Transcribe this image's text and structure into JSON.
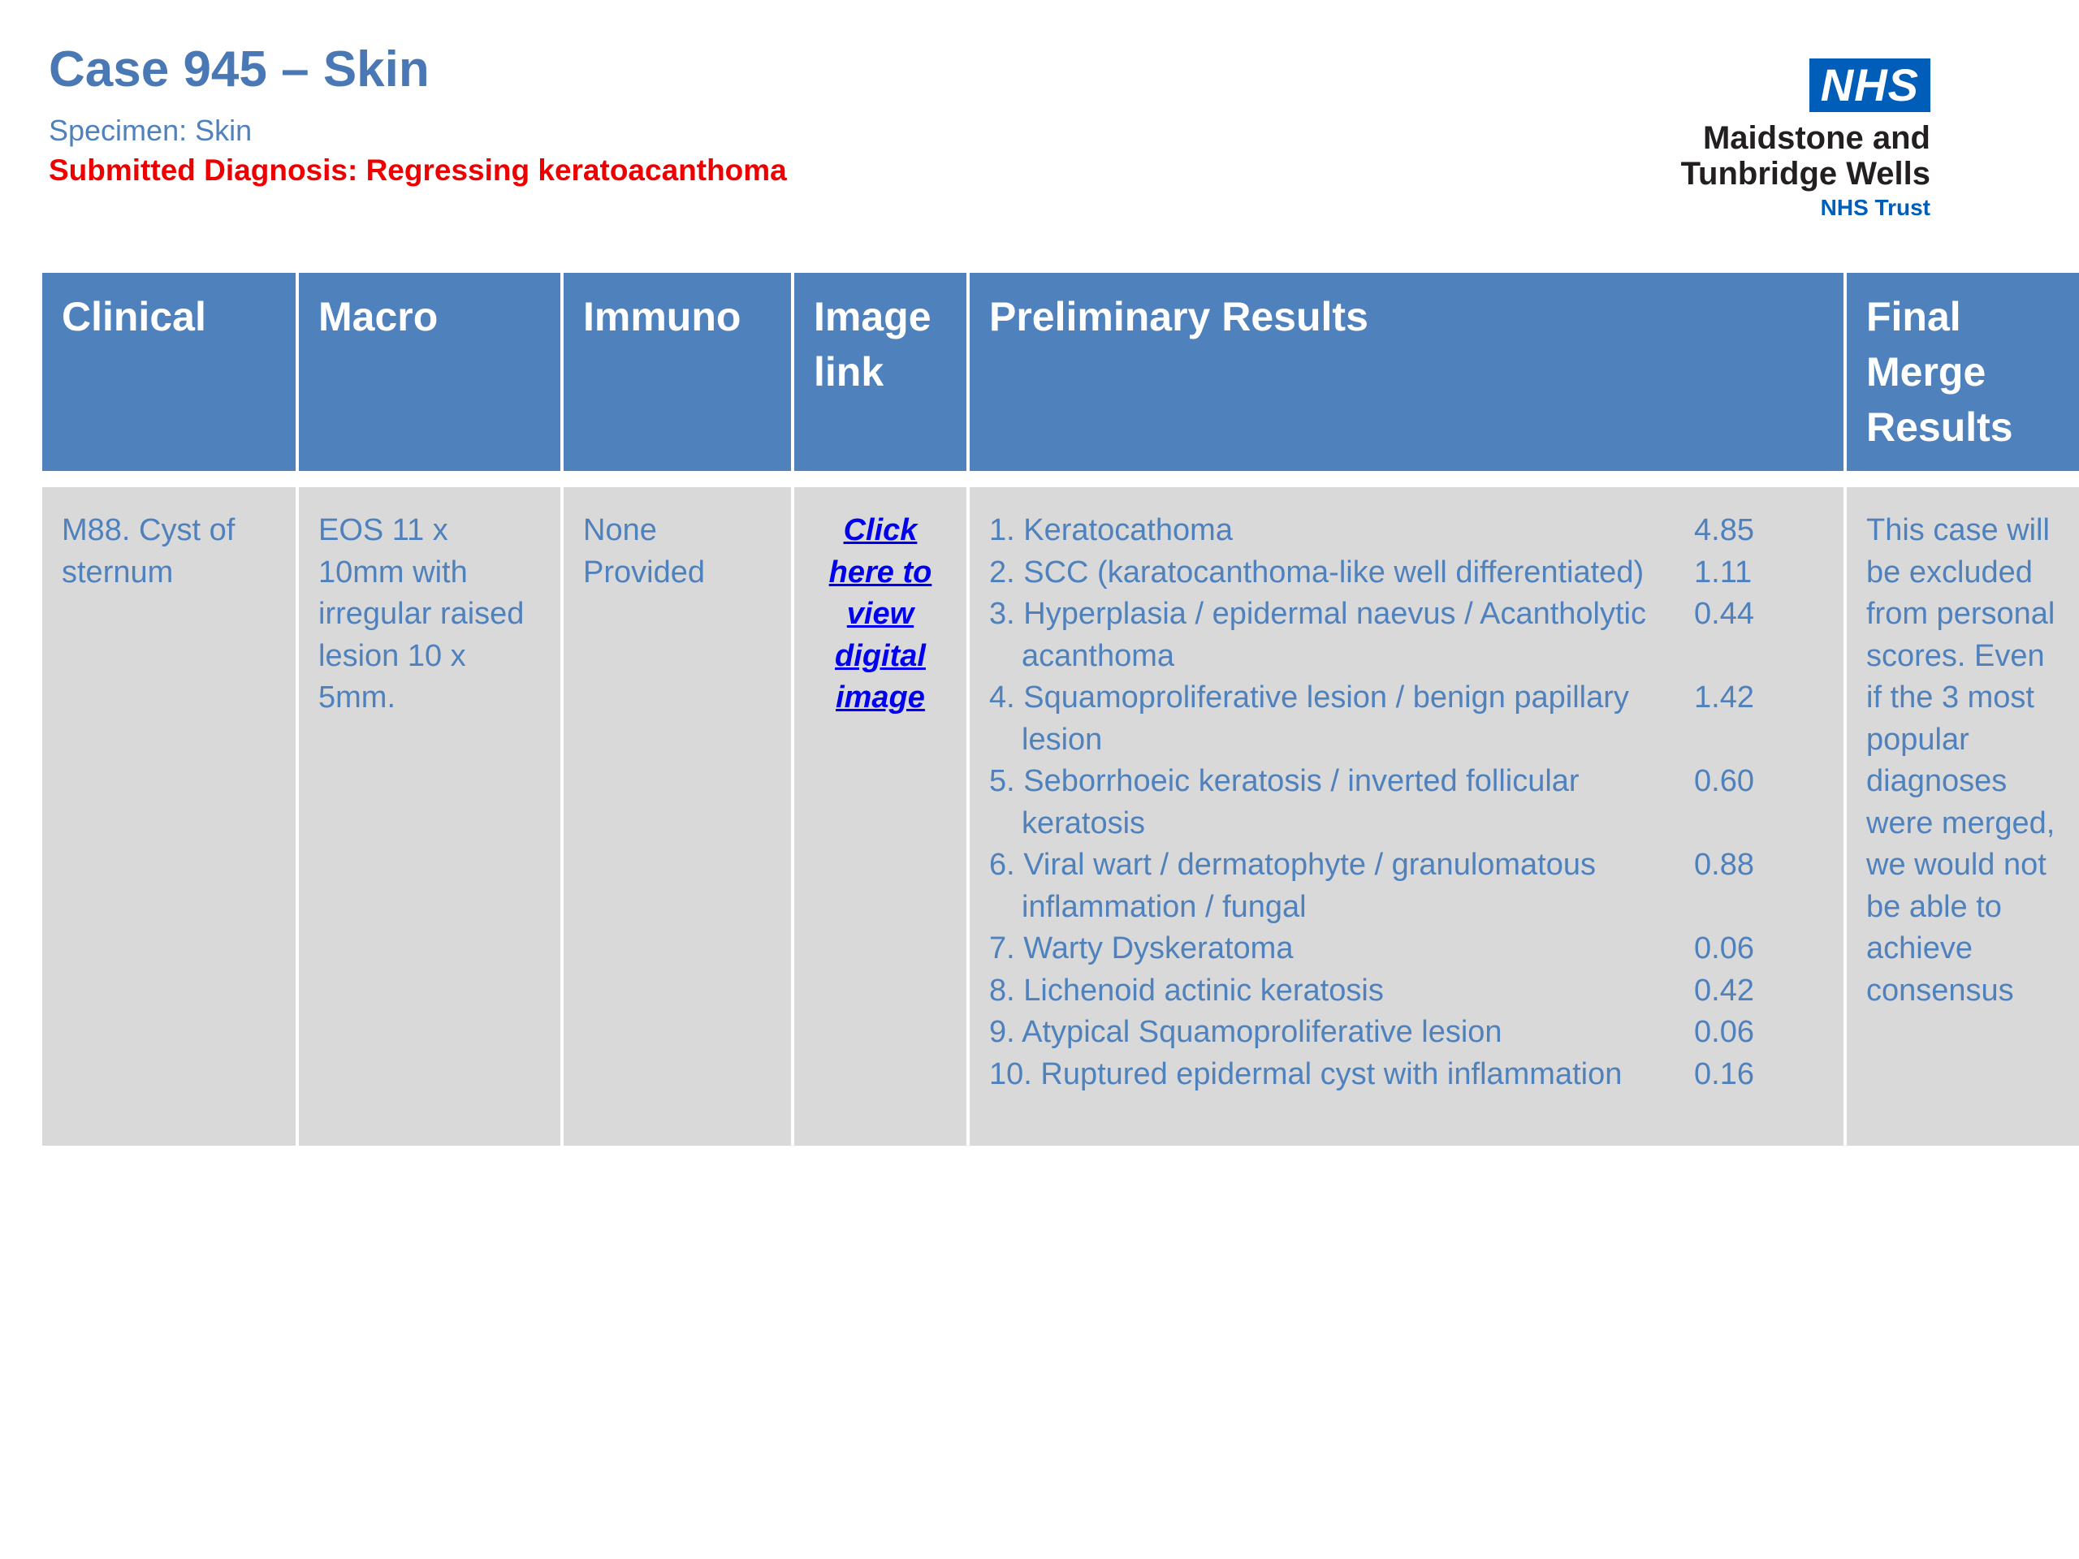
{
  "header": {
    "title": "Case 945 – Skin",
    "specimen": "Specimen: Skin",
    "submitted_diagnosis": "Submitted Diagnosis: Regressing keratoacanthoma"
  },
  "logo": {
    "badge": "NHS",
    "org_line1": "Maidstone and",
    "org_line2": "Tunbridge Wells",
    "org_trust": "NHS Trust"
  },
  "table": {
    "headers": {
      "clinical": "Clinical",
      "macro": "Macro",
      "immuno": "Immuno",
      "image_link_1": "Image",
      "image_link_2": "link",
      "preliminary": "Preliminary Results",
      "final_1": "Final",
      "final_2": "Merge",
      "final_3": "Results"
    },
    "row": {
      "clinical": "M88. Cyst of sternum",
      "macro": "EOS 11 x 10mm with irregular raised lesion 10 x 5mm.",
      "immuno": "None Provided",
      "image_link": {
        "line1": "Click",
        "line2": "here to",
        "line3": "view",
        "line4": "digital",
        "line5": "image"
      },
      "preliminary_results": [
        {
          "label": "1. Keratocathoma",
          "score": "4.85"
        },
        {
          "label": "2. SCC (karatocanthoma-like well differentiated)",
          "score": "1.11"
        },
        {
          "label": "3. Hyperplasia / epidermal naevus / Acantholytic acanthoma",
          "score": "0.44"
        },
        {
          "label": "4. Squamoproliferative lesion / benign papillary lesion",
          "score": "1.42"
        },
        {
          "label": "5. Seborrhoeic keratosis / inverted follicular keratosis",
          "score": "0.60"
        },
        {
          "label": "6. Viral wart / dermatophyte / granulomatous inflammation / fungal",
          "score": "0.88"
        },
        {
          "label": "7. Warty Dyskeratoma",
          "score": "0.06"
        },
        {
          "label": "8. Lichenoid actinic keratosis",
          "score": "0.42"
        },
        {
          "label": "9. Atypical Squamoproliferative lesion",
          "score": "0.06"
        },
        {
          "label": "10. Ruptured epidermal cyst with inflammation",
          "score": "0.16"
        }
      ],
      "final_merge": "This case will be excluded from personal scores. Even if the 3 most popular diagnoses were merged, we would not be able to achieve consensus"
    }
  },
  "colors": {
    "title": "#4a78b4",
    "header_fill": "#4f81bd",
    "cell_fill": "#d9d9d9",
    "body_text": "#4f81bd",
    "alert": "#ee0000",
    "link": "#0000ee",
    "nhs_blue": "#005eb8"
  }
}
